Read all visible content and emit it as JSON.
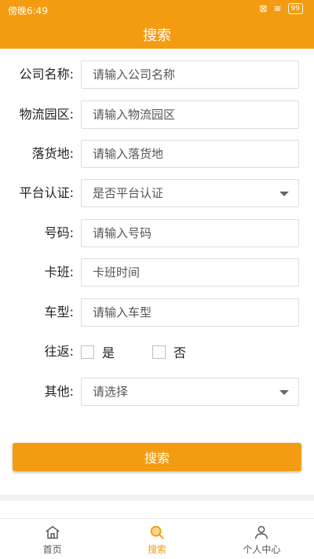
{
  "status_bar": {
    "time": "傍晚6:49",
    "battery": "99"
  },
  "title": "搜索",
  "form": {
    "company": {
      "label": "公司名称:",
      "placeholder": "请输入公司名称"
    },
    "park": {
      "label": "物流园区:",
      "placeholder": "请输入物流园区"
    },
    "location": {
      "label": "落货地:",
      "placeholder": "请输入落货地"
    },
    "platform": {
      "label": "平台认证:",
      "value": "是否平台认证"
    },
    "number": {
      "label": "号码:",
      "placeholder": "请输入号码"
    },
    "shift": {
      "label": "卡班:",
      "placeholder": "卡班时间"
    },
    "vehicle": {
      "label": "车型:",
      "placeholder": "请输入车型"
    },
    "roundtrip": {
      "label": "往返:",
      "yes": "是",
      "no": "否"
    },
    "other": {
      "label": "其他:",
      "value": "请选择"
    }
  },
  "search_button": "搜索",
  "tabs": [
    {
      "label": "首页",
      "icon": "home-icon"
    },
    {
      "label": "搜索",
      "icon": "search-icon"
    },
    {
      "label": "个人中心",
      "icon": "user-icon"
    }
  ],
  "colors": {
    "accent": "#f39c12"
  }
}
